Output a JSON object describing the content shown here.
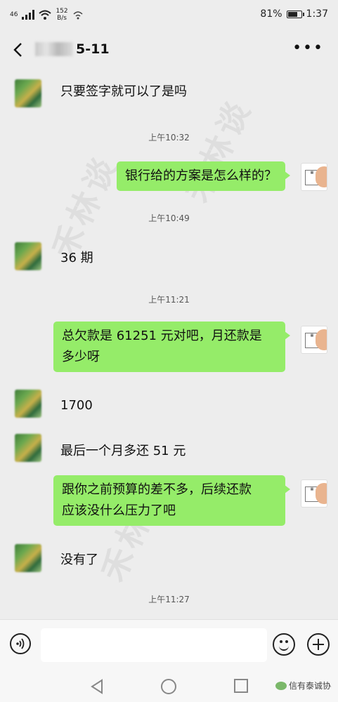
{
  "status_bar": {
    "signal": "46",
    "speed_value": "152",
    "speed_unit": "B/s",
    "battery_percent": "81%",
    "battery_level": 0.81,
    "time": "1:37"
  },
  "header": {
    "title_visible": "5-11",
    "more_label": "•••"
  },
  "watermarks": [
    "禾林谈",
    "禾林谈",
    "禾林谈"
  ],
  "timestamps": [
    "上午10:32",
    "上午10:49",
    "上午11:21",
    "上午11:27"
  ],
  "messages": [
    {
      "side": "left",
      "text": "只要签字就可以了是吗"
    },
    {
      "side": "right",
      "text": "银行给的方案是怎么样的？"
    },
    {
      "side": "left",
      "text": "36 期"
    },
    {
      "side": "right",
      "line1": "总欠款是 61251 元对吧，月还款是",
      "line2": "多少呀"
    },
    {
      "side": "left",
      "text": "1700"
    },
    {
      "side": "left",
      "text": "最后一个月多还 51 元"
    },
    {
      "side": "right",
      "line1": "跟你之前预算的差不多，后续还款",
      "line2": "应该没什么压力了吧"
    },
    {
      "side": "left",
      "text": "没有了"
    }
  ],
  "input_bar": {
    "placeholder": ""
  },
  "footer_brand": "信有泰诚协"
}
